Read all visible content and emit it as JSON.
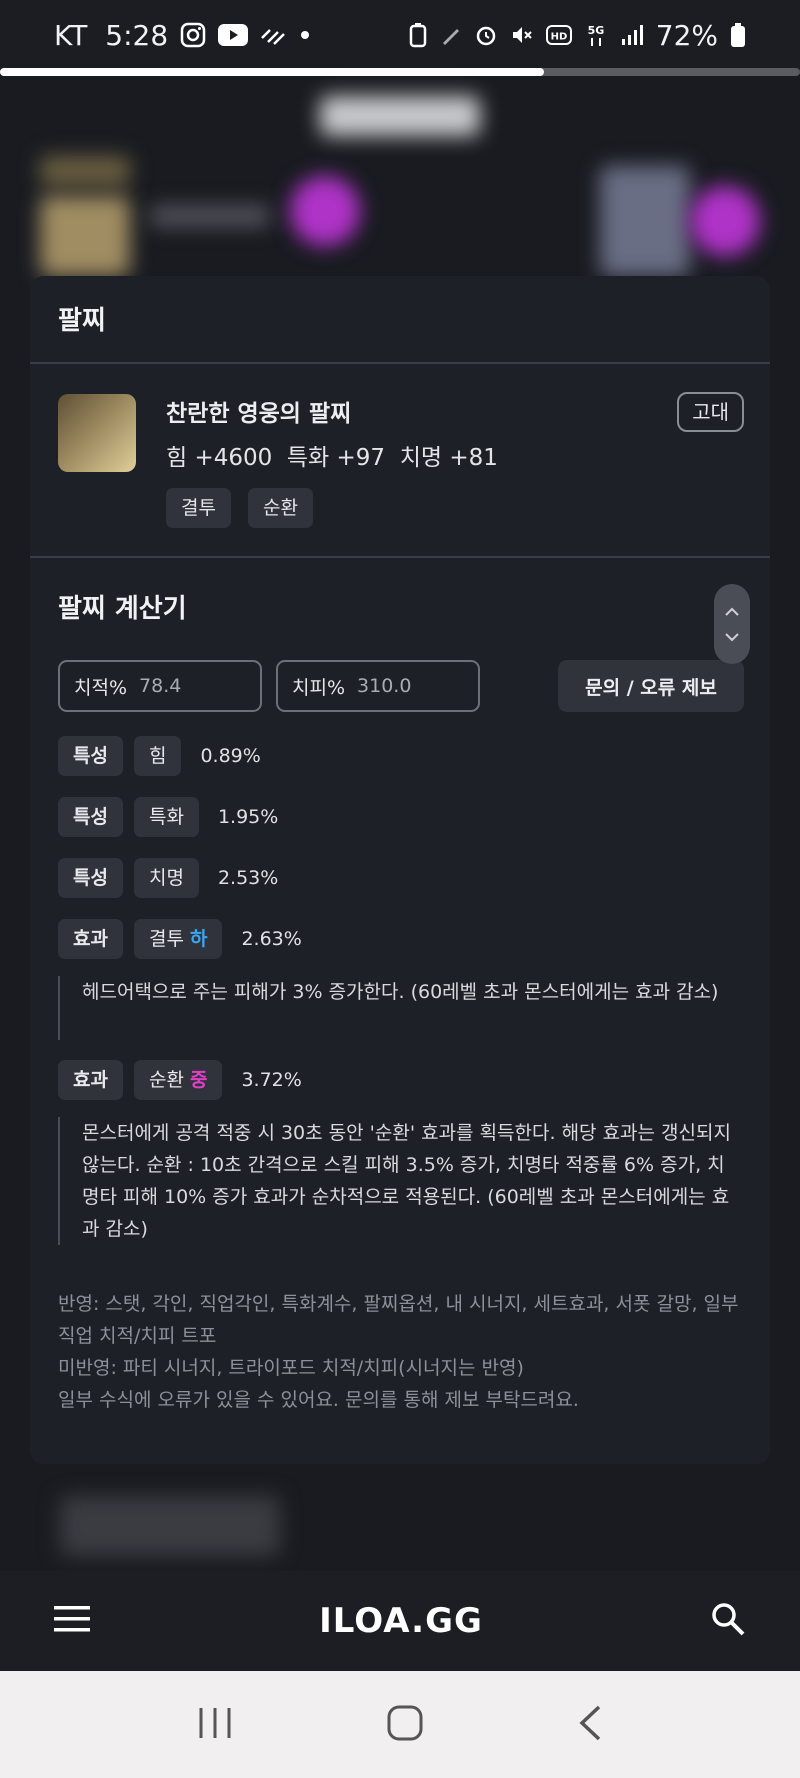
{
  "status_bar": {
    "carrier": "KT",
    "time": "5:28",
    "battery": "72%",
    "icons": [
      "instagram-icon",
      "youtube-icon",
      "sync-icon",
      "dot-icon",
      "battery-saver-icon",
      "pen-icon",
      "alarm-icon",
      "mute-icon",
      "hd-icon",
      "5g-icon",
      "signal-icon",
      "battery-icon"
    ],
    "page_progress": 0.68
  },
  "modal": {
    "title": "팔찌",
    "item": {
      "name": "찬란한 영웅의 팔찌",
      "stats": "힘 +4600  특화 +97  치명 +81",
      "grade": "고대",
      "tags": [
        "결투",
        "순환"
      ]
    },
    "calculator": {
      "title": "팔찌 계산기",
      "crit_rate": {
        "label": "치적%",
        "placeholder": "78.4"
      },
      "crit_damage": {
        "label": "치피%",
        "placeholder": "310.0"
      },
      "report_button": "문의 / 오류 제보",
      "rows": [
        {
          "type": "특성",
          "name": "힘",
          "level": "",
          "value": "0.89%"
        },
        {
          "type": "특성",
          "name": "특화",
          "level": "",
          "value": "1.95%"
        },
        {
          "type": "특성",
          "name": "치명",
          "level": "",
          "value": "2.53%"
        },
        {
          "type": "효과",
          "name": "결투",
          "level": "하",
          "value": "2.63%",
          "description": "헤드어택으로 주는 피해가 3% 증가한다. (60레벨 초과 몬스터에게는 효과 감소)"
        },
        {
          "type": "효과",
          "name": "순환",
          "level": "중",
          "value": "3.72%",
          "description": "몬스터에게 공격 적중 시 30초 동안 '순환' 효과를 획득한다. 해당 효과는 갱신되지 않는다. 순환 : 10초 간격으로 스킬 피해 3.5% 증가, 치명타 적중률 6% 증가, 치명타 피해 10% 증가 효과가 순차적으로 적용된다. (60레벨 초과 몬스터에게는 효과 감소)"
        }
      ],
      "notes": [
        "반영: 스탯, 각인, 직업각인, 특화계수, 팔찌옵션, 내 시너지, 세트효과, 서폿 갈망, 일부 직업 치적/치피 트포",
        "미반영: 파티 시너지, 트라이포드 치적/치피(시너지는 반영)",
        "일부 수식에 오류가 있을 수 있어요. 문의를 통해 제보 부탁드려요."
      ]
    }
  },
  "app_bar": {
    "logo": "ILOA.GG"
  },
  "colors": {
    "level_low": "#3aa7f0",
    "level_mid": "#e040c8",
    "card_bg": "#1e2027",
    "chip_bg": "#30333c"
  }
}
